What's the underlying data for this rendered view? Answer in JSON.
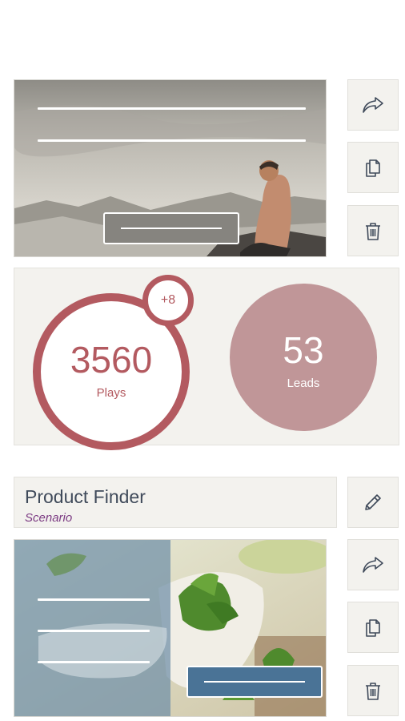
{
  "colors": {
    "accent": "#b35a60",
    "leads_fill": "#c09698",
    "panel_bg": "#f3f2ee",
    "icon": "#3f4a5a",
    "subtitle": "#7b3a82",
    "cta_blue": "#4a7396"
  },
  "card1": {
    "stats": {
      "badge": "+8",
      "plays_value": "3560",
      "plays_label": "Plays",
      "leads_value": "53",
      "leads_label": "Leads"
    },
    "actions": [
      "share-icon",
      "copy-icon",
      "trash-icon"
    ]
  },
  "card2": {
    "title": "Product Finder",
    "subtitle": "Scenario",
    "actions": [
      "pencil-icon",
      "share-icon",
      "copy-icon",
      "trash-icon"
    ]
  }
}
